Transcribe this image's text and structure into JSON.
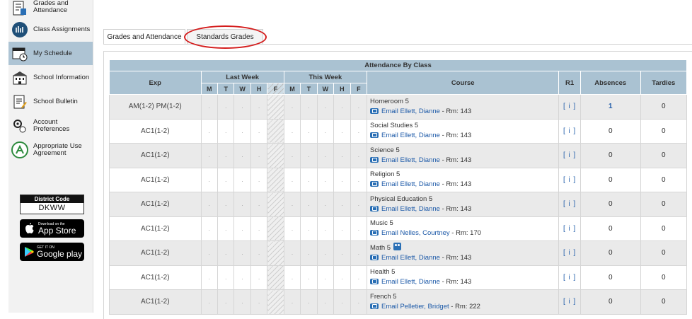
{
  "sidebar": {
    "items": [
      {
        "label": "Grades and Attendance",
        "icon": "grades-icon",
        "active": false
      },
      {
        "label": "Class Assignments",
        "icon": "assignments-icon",
        "active": false
      },
      {
        "label": "My Schedule",
        "icon": "schedule-icon",
        "active": true
      },
      {
        "label": "School Information",
        "icon": "school-icon",
        "active": false
      },
      {
        "label": "School Bulletin",
        "icon": "bulletin-icon",
        "active": false
      },
      {
        "label": "Account Preferences",
        "icon": "preferences-icon",
        "active": false
      },
      {
        "label": "Appropriate Use Agreement",
        "icon": "agreement-icon",
        "active": false
      }
    ],
    "district_code_label": "District Code",
    "district_code": "DKWW",
    "app_store": {
      "small": "Download on the",
      "big": "App Store"
    },
    "google_play": {
      "small": "GET IT ON",
      "big": "Google play"
    }
  },
  "tabs": [
    {
      "label": "Grades and Attendance",
      "active": true
    },
    {
      "label": "Standards Grades",
      "active": false,
      "highlighted": true
    }
  ],
  "table": {
    "title": "Attendance By Class",
    "headers": {
      "exp": "Exp",
      "last_week": "Last Week",
      "this_week": "This Week",
      "course": "Course",
      "r1": "R1",
      "absences": "Absences",
      "tardies": "Tardies",
      "days": [
        "M",
        "T",
        "W",
        "H",
        "F"
      ]
    },
    "rows": [
      {
        "exp": "AM(1-2) PM(1-2)",
        "course": "Homeroom 5",
        "email": "Email Ellett, Dianne",
        "room": " - Rm: 143",
        "r1": "[ i ]",
        "absences": "1",
        "tardies": "0"
      },
      {
        "exp": "AC1(1-2)",
        "course": "Social Studies 5",
        "email": "Email Ellett, Dianne",
        "room": " - Rm: 143",
        "r1": "[ i ]",
        "absences": "0",
        "tardies": "0"
      },
      {
        "exp": "AC1(1-2)",
        "course": "Science 5",
        "email": "Email Ellett, Dianne",
        "room": " - Rm: 143",
        "r1": "[ i ]",
        "absences": "0",
        "tardies": "0"
      },
      {
        "exp": "AC1(1-2)",
        "course": "Religion 5",
        "email": "Email Ellett, Dianne",
        "room": " - Rm: 143",
        "r1": "[ i ]",
        "absences": "0",
        "tardies": "0"
      },
      {
        "exp": "AC1(1-2)",
        "course": "Physical Education 5",
        "email": "Email Ellett, Dianne",
        "room": " - Rm: 143",
        "r1": "[ i ]",
        "absences": "0",
        "tardies": "0"
      },
      {
        "exp": "AC1(1-2)",
        "course": "Music 5",
        "email": "Email Nelles, Courtney",
        "room": " - Rm: 170",
        "r1": "[ i ]",
        "absences": "0",
        "tardies": "0"
      },
      {
        "exp": "AC1(1-2)",
        "course": "Math 5",
        "email": "Email Ellett, Dianne",
        "room": " - Rm: 143",
        "r1": "[ i ]",
        "absences": "0",
        "tardies": "0"
      },
      {
        "exp": "AC1(1-2)",
        "course": "Health 5",
        "email": "Email Ellett, Dianne",
        "room": " - Rm: 143",
        "r1": "[ i ]",
        "absences": "0",
        "tardies": "0"
      },
      {
        "exp": "AC1(1-2)",
        "course": "French 5",
        "email": "Email Pelletier, Bridget",
        "room": " - Rm: 222",
        "r1": "[ i ]",
        "absences": "0",
        "tardies": "0"
      }
    ],
    "day_mark": "."
  }
}
